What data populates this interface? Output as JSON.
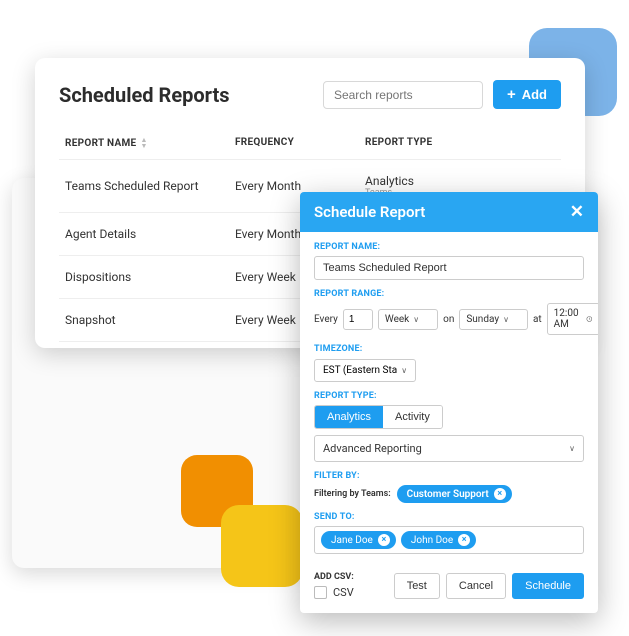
{
  "colors": {
    "accent": "#1e9df0",
    "orange": "#f18f01",
    "yellow": "#f5c518",
    "blue_square": "#7cb3e8"
  },
  "main": {
    "title": "Scheduled Reports",
    "search_placeholder": "Search reports",
    "add_label": "Add",
    "columns": {
      "name": "REPORT NAME",
      "frequency": "FREQUENCY",
      "type": "REPORT TYPE"
    },
    "rows": [
      {
        "name": "Teams Scheduled Report",
        "frequency": "Every Month",
        "type": "Analytics",
        "subtype": "Teams"
      },
      {
        "name": "Agent Details",
        "frequency": "Every Month",
        "type": "",
        "subtype": ""
      },
      {
        "name": "Dispositions",
        "frequency": "Every Week",
        "type": "",
        "subtype": ""
      },
      {
        "name": "Snapshot",
        "frequency": "Every Week",
        "type": "",
        "subtype": ""
      }
    ]
  },
  "modal": {
    "title": "Schedule Report",
    "labels": {
      "report_name": "REPORT NAME:",
      "report_range": "REPORT RANGE:",
      "timezone": "TIMEZONE:",
      "report_type": "REPORT TYPE:",
      "filter_by": "FILTER BY:",
      "send_to": "SEND TO:",
      "add_csv": "ADD CSV:"
    },
    "report_name_value": "Teams Scheduled Report",
    "range": {
      "every_label": "Every",
      "every_value": "1",
      "unit": "Week",
      "on_label": "on",
      "day": "Sunday",
      "at_label": "at",
      "time": "12:00 AM"
    },
    "timezone_value": "EST (Eastern Sta",
    "type_toggle": {
      "analytics": "Analytics",
      "activity": "Activity",
      "active": "analytics"
    },
    "type_select": "Advanced Reporting",
    "filter": {
      "prefix": "Filtering by Teams:",
      "chips": [
        "Customer Support"
      ]
    },
    "send_to_chips": [
      "Jane Doe",
      "John Doe"
    ],
    "csv_label": "CSV",
    "buttons": {
      "test": "Test",
      "cancel": "Cancel",
      "schedule": "Schedule"
    }
  }
}
